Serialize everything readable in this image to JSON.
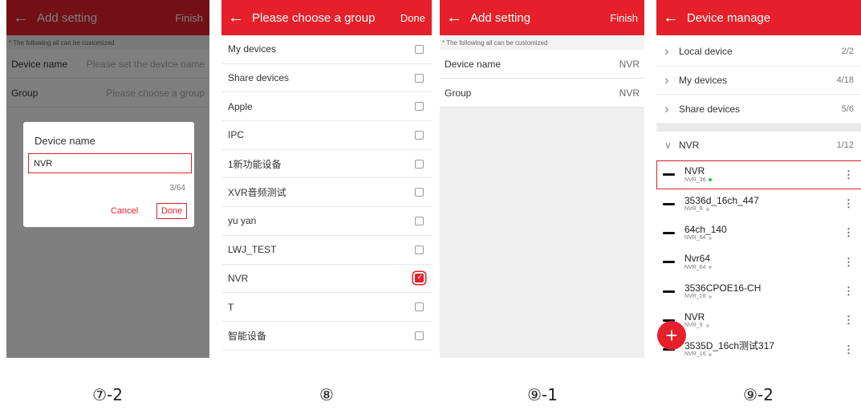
{
  "s1": {
    "back_icon": "arrow-left-icon",
    "title": "Add setting",
    "action": "Finish",
    "hint": "* The following all can be customized",
    "rows": [
      {
        "label": "Device name",
        "value": "Please set the device name"
      },
      {
        "label": "Group",
        "value": "Please choose a group"
      }
    ],
    "dialog": {
      "title": "Device name",
      "input_value": "NVR",
      "count": "3/64",
      "cancel": "Cancel",
      "done": "Done"
    },
    "caption": "⑦-2"
  },
  "s2": {
    "back_icon": "arrow-left-icon",
    "title": "Please choose a group",
    "action": "Done",
    "groups": [
      {
        "label": "My devices",
        "checked": false
      },
      {
        "label": "Share devices",
        "checked": false
      },
      {
        "label": "Apple",
        "checked": false
      },
      {
        "label": "IPC",
        "checked": false
      },
      {
        "label": "1新功能设备",
        "checked": false
      },
      {
        "label": "XVR音频测试",
        "checked": false
      },
      {
        "label": "yu yan",
        "checked": false
      },
      {
        "label": "LWJ_TEST",
        "checked": false
      },
      {
        "label": "NVR",
        "checked": true
      },
      {
        "label": "T",
        "checked": false
      },
      {
        "label": "智能设备",
        "checked": false
      }
    ],
    "caption": "⑧"
  },
  "s3": {
    "back_icon": "arrow-left-icon",
    "title": "Add setting",
    "action": "Finish",
    "hint": "* The following all can be customized",
    "rows": [
      {
        "label": "Device name",
        "value": "NVR"
      },
      {
        "label": "Group",
        "value": "NVR"
      }
    ],
    "caption": "⑨-1"
  },
  "s4": {
    "back_icon": "arrow-left-icon",
    "title": "Device manage",
    "groups": [
      {
        "label": "Local device",
        "count": "2/2",
        "icon": "chevron-right-icon"
      },
      {
        "label": "My devices",
        "count": "4/18",
        "icon": "chevron-right-icon"
      },
      {
        "label": "Share devices",
        "count": "5/6",
        "icon": "chevron-right-icon"
      }
    ],
    "expanded": {
      "label": "NVR",
      "count": "1/12",
      "icon": "chevron-down-icon"
    },
    "devices": [
      {
        "name": "NVR",
        "sub": "NVR_36",
        "online": true
      },
      {
        "name": "3536d_16ch_447",
        "sub": "NVR_9",
        "online": false
      },
      {
        "name": "64ch_140",
        "sub": "NVR_64",
        "online": false
      },
      {
        "name": "Nvr64",
        "sub": "NVR_64",
        "online": false
      },
      {
        "name": "3536CPOE16-CH",
        "sub": "NVR_16",
        "online": false
      },
      {
        "name": "NVR",
        "sub": "NVR_9",
        "online": false
      },
      {
        "name": "3535D_16ch测试317",
        "sub": "NVR_16",
        "online": false
      }
    ],
    "more_icon": "more-vertical-icon",
    "fab_icon": "plus-icon",
    "caption": "⑨-2"
  },
  "colors": {
    "accent": "#e5202a",
    "online": "#28c446"
  }
}
